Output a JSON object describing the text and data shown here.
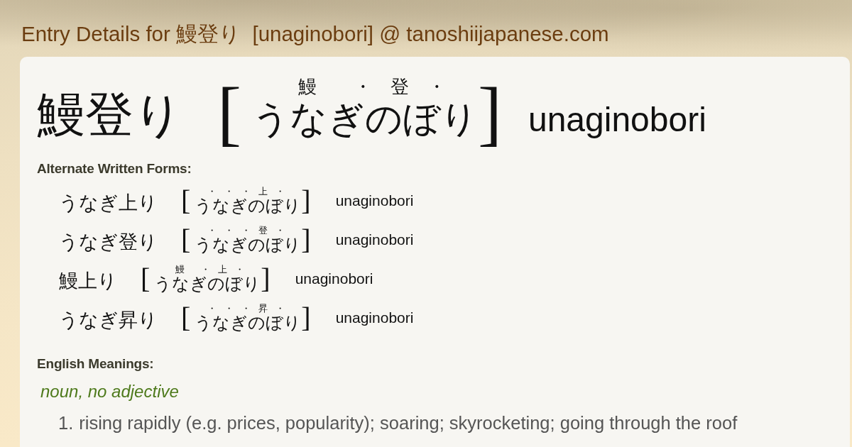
{
  "page_title": "Entry Details for 鰻登り  [unaginobori] @ tanoshiijapanese.com",
  "entry": {
    "written": "鰻登り",
    "reading": {
      "open_bracket": "[",
      "parts": [
        {
          "kanji": "鰻",
          "separator": "・",
          "kana": "うなぎ"
        },
        {
          "kanji": "登",
          "separator": "・",
          "kana": "のぼ"
        },
        {
          "kana": "り"
        }
      ],
      "close_bracket": "]"
    },
    "romaji": "unaginobori"
  },
  "alternate_forms": {
    "label": "Alternate Written Forms:",
    "items": [
      {
        "written": "うなぎ上り",
        "reading": {
          "open_bracket": "[",
          "parts": [
            {
              "separator": "・",
              "kana": "う"
            },
            {
              "separator": "・",
              "kana": "な"
            },
            {
              "separator": "・",
              "kana": "ぎ"
            },
            {
              "kanji": "上",
              "separator": "・",
              "kana": "のぼ"
            },
            {
              "kana": "り"
            }
          ],
          "close_bracket": "]"
        },
        "romaji": "unaginobori"
      },
      {
        "written": "うなぎ登り",
        "reading": {
          "open_bracket": "[",
          "parts": [
            {
              "separator": "・",
              "kana": "う"
            },
            {
              "separator": "・",
              "kana": "な"
            },
            {
              "separator": "・",
              "kana": "ぎ"
            },
            {
              "kanji": "登",
              "separator": "・",
              "kana": "のぼ"
            },
            {
              "kana": "り"
            }
          ],
          "close_bracket": "]"
        },
        "romaji": "unaginobori"
      },
      {
        "written": "鰻上り",
        "reading": {
          "open_bracket": "[",
          "parts": [
            {
              "kanji": "鰻",
              "separator": "・",
              "kana": "うなぎ"
            },
            {
              "kanji": "上",
              "separator": "・",
              "kana": "のぼ"
            },
            {
              "kana": "り"
            }
          ],
          "close_bracket": "]"
        },
        "romaji": "unaginobori"
      },
      {
        "written": "うなぎ昇り",
        "reading": {
          "open_bracket": "[",
          "parts": [
            {
              "separator": "・",
              "kana": "う"
            },
            {
              "separator": "・",
              "kana": "な"
            },
            {
              "separator": "・",
              "kana": "ぎ"
            },
            {
              "kanji": "昇",
              "separator": "・",
              "kana": "のぼ"
            },
            {
              "kana": "り"
            }
          ],
          "close_bracket": "]"
        },
        "romaji": "unaginobori"
      }
    ]
  },
  "meanings": {
    "label": "English Meanings:",
    "part_of_speech": "noun, no adjective",
    "senses": [
      {
        "number": "1.",
        "text": "rising rapidly (e.g. prices, popularity); soaring; skyrocketing; going through the roof"
      }
    ]
  }
}
